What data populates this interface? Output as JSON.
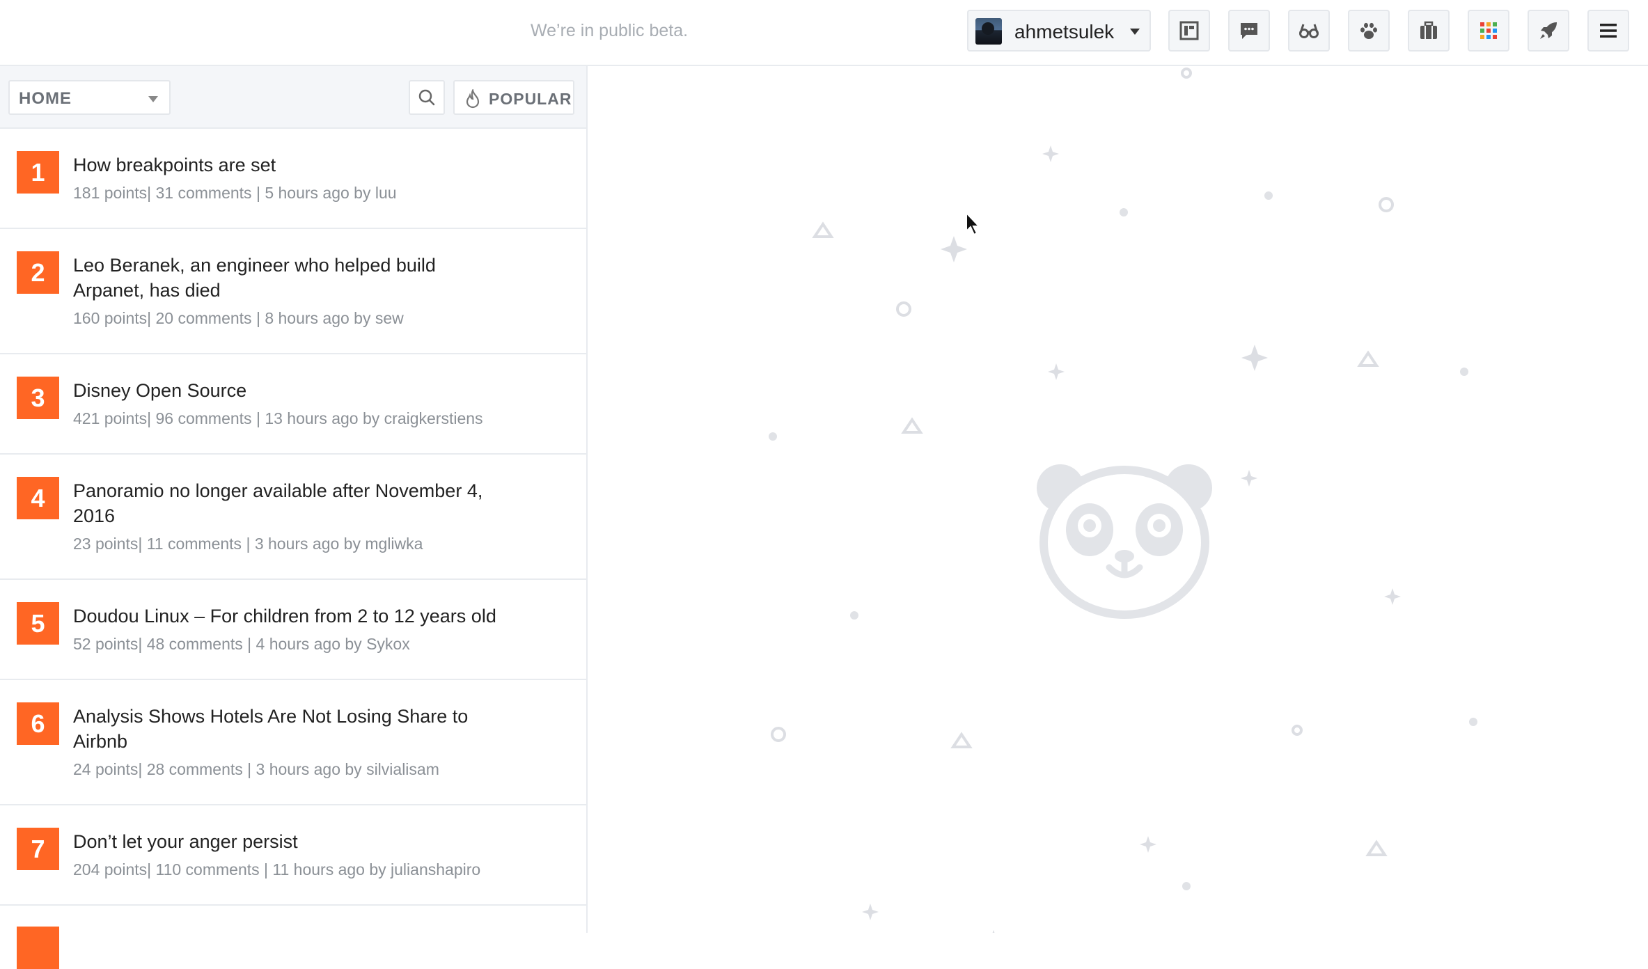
{
  "header": {
    "beta_text": "We’re in public beta.",
    "username": "ahmetsulek",
    "icons": [
      "board-icon",
      "chat-icon",
      "glasses-icon",
      "paw-icon",
      "briefcase-icon",
      "apps-grid-icon",
      "rocket-icon",
      "menu-icon"
    ]
  },
  "filter": {
    "category": "HOME",
    "sort_label": "POPULAR"
  },
  "stories": [
    {
      "rank": "1",
      "title": "How breakpoints are set",
      "meta": "181 points| 31 comments | 5 hours ago by luu"
    },
    {
      "rank": "2",
      "title": "Leo Beranek, an engineer who helped build Arpanet, has died",
      "meta": "160 points| 20 comments | 8 hours ago by sew"
    },
    {
      "rank": "3",
      "title": "Disney Open Source",
      "meta": "421 points| 96 comments | 13 hours ago by craigkerstiens"
    },
    {
      "rank": "4",
      "title": "Panoramio no longer available after November 4, 2016",
      "meta": "23 points| 11 comments | 3 hours ago by mgliwka"
    },
    {
      "rank": "5",
      "title": "Doudou Linux – For children from 2 to 12 years old",
      "meta": "52 points| 48 comments | 4 hours ago by Sykox"
    },
    {
      "rank": "6",
      "title": "Analysis Shows Hotels Are Not Losing Share to Airbnb",
      "meta": "24 points| 28 comments | 3 hours ago by silvialisam"
    },
    {
      "rank": "7",
      "title": "Don’t let your anger persist",
      "meta": "204 points| 110 comments | 11 hours ago by julianshapiro"
    }
  ],
  "colors": {
    "accent": "#ff6624",
    "muted_text": "#8b9096",
    "border": "#e8ebef",
    "decor": "#dcdee3"
  }
}
